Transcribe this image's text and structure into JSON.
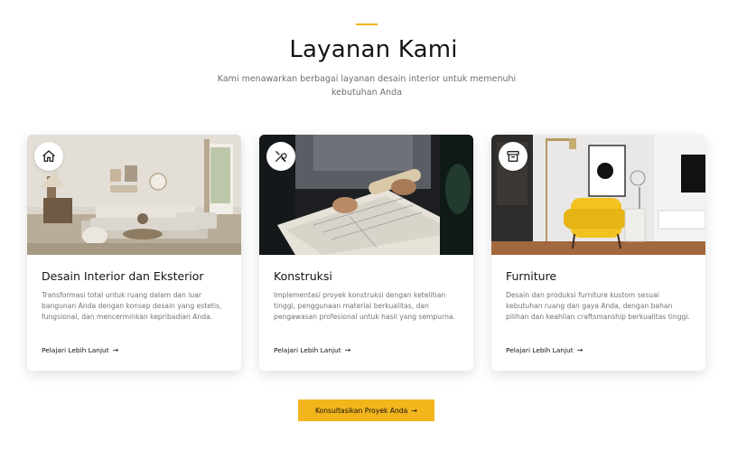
{
  "section": {
    "title": "Layanan Kami",
    "subtitle": "Kami menawarkan berbagai layanan desain interior untuk memenuhi kebutuhan Anda"
  },
  "services": [
    {
      "icon": "home-icon",
      "title": "Desain Interior dan Eksterior",
      "description": "Transformasi total untuk ruang dalam dan luar bangunan Anda dengan konsep desain yang estetis, fungsional, dan mencerminkan kepribadian Anda.",
      "link_label": "Pelajari Lebih Lanjut"
    },
    {
      "icon": "tools-icon",
      "title": "Konstruksi",
      "description": "Implementasi proyek konstruksi dengan ketelitian tinggi, penggunaan material berkualitas, dan pengawasan profesional untuk hasil yang sempurna.",
      "link_label": "Pelajari Lebih Lanjut"
    },
    {
      "icon": "archive-box-icon",
      "title": "Furniture",
      "description": "Desain dan produksi furniture kustom sesuai kebutuhan ruang dan gaya Anda, dengan bahan pilihan dan keahlian craftsmanship berkualitas tinggi.",
      "link_label": "Pelajari Lebih Lanjut"
    }
  ],
  "cta": {
    "label": "Konsultasikan Proyek Anda"
  },
  "colors": {
    "accent": "#f2b51c",
    "title": "#141414",
    "muted": "#747474"
  }
}
